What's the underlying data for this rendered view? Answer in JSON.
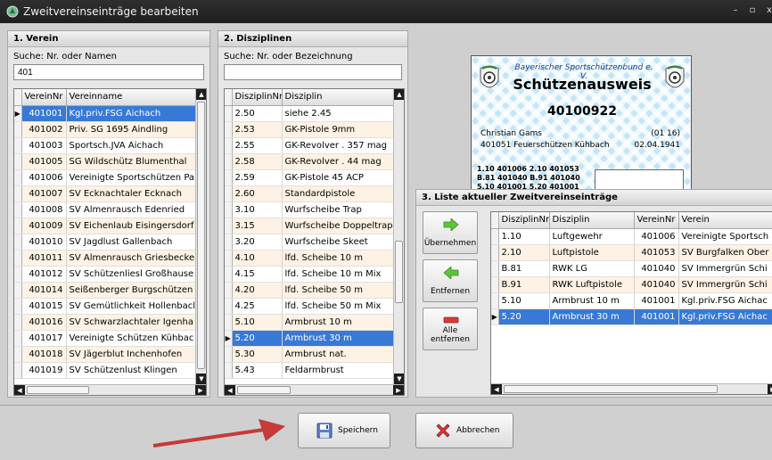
{
  "window": {
    "title": "Zweitvereinseinträge bearbeiten",
    "min": "–",
    "max": "▫",
    "close": "x"
  },
  "verein": {
    "header": "1. Verein",
    "search_label": "Suche: Nr. oder Namen",
    "search_value": "401",
    "columns": [
      "VereinNr",
      "Vereinname"
    ],
    "rows": [
      [
        "401001",
        "Kgl.priv.FSG Aichach"
      ],
      [
        "401002",
        "Priv. SG 1695 Aindling"
      ],
      [
        "401003",
        "Sportsch.JVA Aichach"
      ],
      [
        "401005",
        "SG Wildschütz Blumenthal"
      ],
      [
        "401006",
        "Vereinigte Sportschützen Pa"
      ],
      [
        "401007",
        "SV Ecknachtaler Ecknach"
      ],
      [
        "401008",
        "SV Almenrausch Edenried"
      ],
      [
        "401009",
        "SV Eichenlaub Eisingersdorf"
      ],
      [
        "401010",
        "SV Jagdlust Gallenbach"
      ],
      [
        "401011",
        "SV Almenrausch Griesbecke"
      ],
      [
        "401012",
        "SV Schützenliesl Großhause"
      ],
      [
        "401014",
        "Seißenberger Burgschützen"
      ],
      [
        "401015",
        "SV Gemütlichkeit Hollenbacl"
      ],
      [
        "401016",
        "SV Schwarzlachtaler Igenha"
      ],
      [
        "401017",
        "Vereinigte Schützen Kühbac"
      ],
      [
        "401018",
        "SV Jägerblut Inchenhofen"
      ],
      [
        "401019",
        "SV Schützenlust Klingen"
      ]
    ]
  },
  "disziplinen": {
    "header": "2. Disziplinen",
    "search_label": "Suche: Nr. oder Bezeichnung",
    "search_value": "",
    "columns": [
      "DisziplinNr",
      "Disziplin"
    ],
    "rows": [
      [
        "2.50",
        "siehe 2.45"
      ],
      [
        "2.53",
        "GK-Pistole 9mm"
      ],
      [
        "2.55",
        "GK-Revolver . 357 mag"
      ],
      [
        "2.58",
        "GK-Revolver . 44 mag"
      ],
      [
        "2.59",
        "GK-Pistole 45 ACP"
      ],
      [
        "2.60",
        "Standardpistole"
      ],
      [
        "3.10",
        "Wurfscheibe Trap"
      ],
      [
        "3.15",
        "Wurfscheibe Doppeltrap"
      ],
      [
        "3.20",
        "Wurfscheibe Skeet"
      ],
      [
        "4.10",
        "lfd. Scheibe 10 m"
      ],
      [
        "4.15",
        "lfd. Scheibe 10 m Mix"
      ],
      [
        "4.20",
        "lfd. Scheibe 50 m"
      ],
      [
        "4.25",
        "lfd. Scheibe 50 m Mix"
      ],
      [
        "5.10",
        "Armbrust 10 m"
      ],
      [
        "5.20",
        "Armbrust 30 m"
      ],
      [
        "5.30",
        "Armbrust nat."
      ],
      [
        "5.43",
        "Feldarmbrust"
      ]
    ]
  },
  "card": {
    "org": "Bayerischer Sportschützenbund e. V.",
    "title": "Schützenausweis",
    "number": "40100922",
    "name": "Christian Gams",
    "code": "(01 16)",
    "club": "401051 Feuerschützen Kühbach",
    "birthdate": "02.04.1941",
    "line1": "1.10 401006  2.10 401053",
    "line2": "B.81 401040  B.91 401040",
    "line3": "5.10 401001  5.20 401001"
  },
  "liste": {
    "header": "3. Liste aktueller Zweitvereinseinträge",
    "columns": [
      "DisziplinNr",
      "Disziplin",
      "VereinNr",
      "Verein"
    ],
    "rows": [
      [
        "1.10",
        "Luftgewehr",
        "401006",
        "Vereinigte Sportsch"
      ],
      [
        "2.10",
        "Luftpistole",
        "401053",
        "SV Burgfalken Ober"
      ],
      [
        "B.81",
        "RWK LG",
        "401040",
        "SV Immergrün Schi"
      ],
      [
        "B.91",
        "RWK Luftpistole",
        "401040",
        "SV Immergrün Schi"
      ],
      [
        "5.10",
        "Armbrust 10 m",
        "401001",
        "Kgl.priv.FSG Aichac"
      ],
      [
        "5.20",
        "Armbrust 30 m",
        "401001",
        "Kgl.priv.FSG Aichac"
      ]
    ]
  },
  "actions": {
    "uebernehmen": "Übernehmen",
    "entfernen": "Entfernen",
    "alle_entfernen": "Alle entfernen"
  },
  "footer": {
    "save": "Speichern",
    "cancel": "Abbrechen"
  },
  "colors": {
    "selection": "#3979d6",
    "alt_row": "#fdf2e3",
    "arrow": "#c63a3a",
    "green_arrow": "#5cc43c",
    "red_minus": "#d83a3a"
  }
}
